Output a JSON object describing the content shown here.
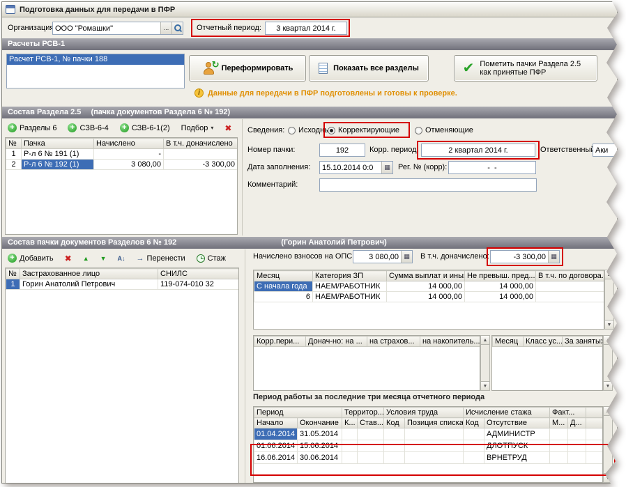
{
  "window": {
    "title": "Подготовка данных для передачи в ПФР"
  },
  "toolbar_top": {
    "org_label": "Организация:",
    "org_value": "ООО \"Ромашки\"",
    "ellipsis": "...",
    "period_label": "Отчетный период:",
    "period_value": "3 квартал 2014 г."
  },
  "rsv": {
    "header": "Расчеты РСВ-1",
    "list_item": "Расчет РСВ-1, № пачки 188",
    "reform_button": "Переформировать",
    "show_all_button": "Показать все разделы",
    "mark_button": "Пометить пачки Раздела 2.5 как принятые ПФР",
    "info_text": "Данные для передачи в ПФР подготовлены и готовы к проверке."
  },
  "section25": {
    "header": "Состав Раздела 2.5",
    "header_note": "(пачка документов Раздела 6 № 192)",
    "btn_razdely6": "Разделы 6",
    "btn_szv64": "СЗВ-6-4",
    "btn_szv612": "СЗВ-6-1(2)",
    "btn_podbor": "Подбор",
    "packs_table": {
      "col_num": "№",
      "col_pack": "Пачка",
      "col_accrued": "Начислено",
      "col_extra": "В т.ч. доначислено",
      "rows": [
        {
          "num": "1",
          "pack": "Р-л 6 № 191 (1)",
          "accrued": "-",
          "extra": ""
        },
        {
          "num": "2",
          "pack": "Р-л 6 № 192 (1)",
          "accrued": "3 080,00",
          "extra": "-3 300,00"
        }
      ]
    },
    "form": {
      "svedeniya": "Сведения:",
      "radio_original": "Исходные",
      "radio_corrective": "Корректирующие",
      "radio_cancelling": "Отменяющие",
      "pack_no_label": "Номер пачки:",
      "pack_no": "192",
      "corr_period_label": "Корр. период:",
      "corr_period": "2 квартал 2014 г.",
      "responsible_label": "Ответственный:",
      "responsible": "Аки",
      "fill_date_label": "Дата заполнения:",
      "fill_date": "15.10.2014 0:0",
      "reg_no_label": "Рег. № (корр):",
      "reg_no": "-  -",
      "comment_label": "Комментарий:",
      "comment": ""
    }
  },
  "pack6": {
    "header": "Состав пачки документов Разделов 6 № 192",
    "header_note": "(Горин Анатолий Петрович)",
    "btn_add": "Добавить",
    "btn_move": "Перенести",
    "btn_stazh": "Стаж",
    "persons_table": {
      "col_num": "№",
      "col_person": "Застрахованное лицо",
      "col_snils": "СНИЛС",
      "rows": [
        {
          "num": "1",
          "person": "Горин Анатолий Петрович",
          "snils": "119-074-010 32"
        }
      ]
    },
    "ops_label": "Начислено взносов на ОПС:",
    "ops_value": "3 080,00",
    "extra_label": "В т.ч. доначислено:",
    "extra_value": "-3 300,00",
    "months_table": {
      "col_month": "Месяц",
      "col_category": "Категория ЗП",
      "col_sum": "Сумма выплат и иных...",
      "col_limit": "Не превыш. пред...",
      "col_contract": "В т.ч. по договора...",
      "rows": [
        {
          "month": "С начала года",
          "category": "НАЕМ/РАБОТНИК",
          "sum": "14 000,00",
          "limit": "14 000,00",
          "contract": ""
        },
        {
          "month": "6",
          "category": "НАЕМ/РАБОТНИК",
          "sum": "14 000,00",
          "limit": "14 000,00",
          "contract": ""
        }
      ]
    },
    "corr_table": {
      "col_corr_period": "Корр.пери...",
      "col_extra_on": "Донач-но: на ...",
      "col_insurance": "на страхов...",
      "col_funded": "на накопитель..."
    },
    "special_table": {
      "col_month": "Месяц",
      "col_class": "Класс ус...",
      "col_busy": "За занятых ..."
    },
    "periods_label": "Период работы за последние три месяца отчетного периода",
    "periods_table": {
      "grp_period": "Период",
      "grp_terr": "Территор...",
      "grp_conditions": "Условия труда",
      "grp_calc": "Исчисление стажа",
      "grp_fact": "Факт...",
      "col_start": "Начало",
      "col_end": "Окончание",
      "col_k": "К...",
      "col_rate": "Став...",
      "col_code1": "Код",
      "col_position": "Позиция списка",
      "col_code2": "Код",
      "col_absence": "Отсутствие",
      "col_m": "М...",
      "col_d": "Д...",
      "rows": [
        {
          "start": "01.04.2014",
          "end": "31.05.2014",
          "absence": "АДМИНИСТР"
        },
        {
          "start": "01.06.2014",
          "end": "15.06.2014",
          "absence": "ДЛОТПУСК"
        },
        {
          "start": "16.06.2014",
          "end": "30.06.2014",
          "absence": "ВРНЕТРУД"
        }
      ]
    }
  },
  "icons": {
    "plus": "+",
    "delete": "✖",
    "dropdown": "▾",
    "check": "✔",
    "up": "▲",
    "down": "▼",
    "sort": "А↓",
    "move": "→",
    "info": "i",
    "calendar": "▦",
    "calc": "▦",
    "refresh": "↻",
    "scroll_up": "▲",
    "scroll_down": "▼"
  }
}
